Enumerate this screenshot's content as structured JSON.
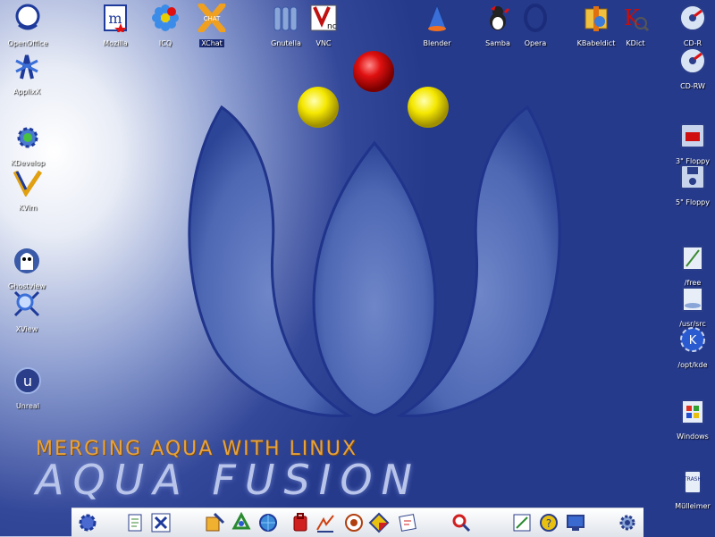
{
  "desktop": {
    "slogan": "MERGING AQUA WITH LINUX",
    "brand": "AQUA FUSION",
    "icons_top": [
      {
        "label": "OpenOffice",
        "icon": "openoffice-icon"
      },
      {
        "label": "Mozilla",
        "icon": "mozilla-icon"
      },
      {
        "label": "ICQ",
        "icon": "icq-icon"
      },
      {
        "label": "XChat",
        "icon": "xchat-icon"
      },
      {
        "label": "Gnutella",
        "icon": "gnutella-icon"
      },
      {
        "label": "VNC",
        "icon": "vnc-icon"
      },
      {
        "label": "Blender",
        "icon": "blender-icon"
      },
      {
        "label": "Samba",
        "icon": "samba-icon"
      },
      {
        "label": "Opera",
        "icon": "opera-icon"
      },
      {
        "label": "KBabeldict",
        "icon": "kbabeldict-icon"
      },
      {
        "label": "KDict",
        "icon": "kdict-icon"
      }
    ],
    "icons_left": [
      {
        "label": "ApplixX",
        "icon": "applix-icon"
      },
      {
        "label": "KDevelop",
        "icon": "kdevelop-icon"
      },
      {
        "label": "KVim",
        "icon": "kvim-icon"
      },
      {
        "label": "Ghostview",
        "icon": "ghostview-icon"
      },
      {
        "label": "XView",
        "icon": "xview-icon"
      },
      {
        "label": "Unreal",
        "icon": "unreal-icon"
      }
    ],
    "icons_right": [
      {
        "label": "CD-R",
        "icon": "cdr-icon"
      },
      {
        "label": "CD-RW",
        "icon": "cdrw-icon"
      },
      {
        "label": "3\" Floppy",
        "icon": "floppy-3-icon"
      },
      {
        "label": "5\" Floppy",
        "icon": "floppy-5-icon"
      },
      {
        "label": "/free",
        "icon": "drive-free-icon"
      },
      {
        "label": "/usr/src",
        "icon": "drive-usrsrc-icon"
      },
      {
        "label": "/opt/kde",
        "icon": "drive-optkde-icon"
      },
      {
        "label": "Windows",
        "icon": "windows-drive-icon"
      },
      {
        "label": "Mülleimer",
        "icon": "trash-icon"
      }
    ]
  },
  "taskbar": {
    "buttons": [
      "kde-menu-icon",
      "editor-icon",
      "xfig-icon",
      "paint-icon",
      "recycle-icon",
      "browser-icon",
      "bag-icon",
      "draw-icon",
      "gimp-icon",
      "diamond-icon",
      "notes-icon",
      "search-tool-icon",
      "text-editor-icon",
      "help-icon",
      "monitor-icon",
      "settings-icon"
    ]
  },
  "colors": {
    "background": "#263a8c",
    "slogan": "#e8a23a",
    "taskbar": "#e8ebf0"
  }
}
